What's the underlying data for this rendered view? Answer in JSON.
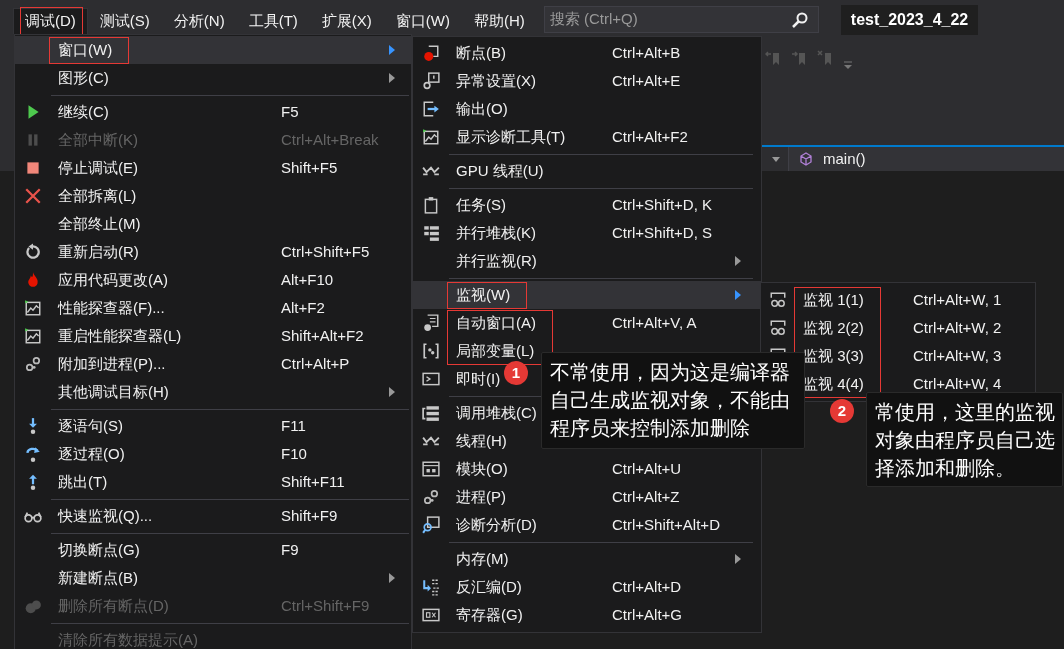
{
  "menubar": [
    {
      "label": "调试(D)",
      "selected": true,
      "annotated": true
    },
    {
      "label": "测试(S)",
      "selected": false,
      "annotated": false
    },
    {
      "label": "分析(N)",
      "selected": false,
      "annotated": false
    },
    {
      "label": "工具(T)",
      "selected": false,
      "annotated": false
    },
    {
      "label": "扩展(X)",
      "selected": false,
      "annotated": false
    },
    {
      "label": "窗口(W)",
      "selected": false,
      "annotated": false
    },
    {
      "label": "帮助(H)",
      "selected": false,
      "annotated": false
    }
  ],
  "search": {
    "placeholder": "搜索 (Ctrl+Q)"
  },
  "solution_title": "test_2023_4_22",
  "editor": {
    "function_dropdown": "main()"
  },
  "debug_menu": [
    {
      "kind": "annotated_group",
      "items": [
        {
          "kind": "item",
          "label": "窗口(W)",
          "submenu": true,
          "selected": true,
          "disabled": false
        }
      ]
    },
    {
      "kind": "item",
      "label": "图形(C)",
      "submenu": true,
      "selected": false,
      "disabled": false
    },
    {
      "kind": "separator"
    },
    {
      "kind": "item",
      "label": "继续(C)",
      "shortcut": "F5",
      "submenu": false,
      "selected": false,
      "disabled": false
    },
    {
      "kind": "item",
      "label": "全部中断(K)",
      "shortcut": "Ctrl+Alt+Break",
      "submenu": false,
      "selected": false,
      "disabled": true
    },
    {
      "kind": "item",
      "label": "停止调试(E)",
      "shortcut": "Shift+F5",
      "submenu": false,
      "selected": false,
      "disabled": false
    },
    {
      "kind": "item",
      "label": "全部拆离(L)",
      "submenu": false,
      "selected": false,
      "disabled": false
    },
    {
      "kind": "item",
      "label": "全部终止(M)",
      "submenu": false,
      "selected": false,
      "disabled": false
    },
    {
      "kind": "item",
      "label": "重新启动(R)",
      "shortcut": "Ctrl+Shift+F5",
      "submenu": false,
      "selected": false,
      "disabled": false
    },
    {
      "kind": "item",
      "label": "应用代码更改(A)",
      "shortcut": "Alt+F10",
      "submenu": false,
      "selected": false,
      "disabled": false
    },
    {
      "kind": "item",
      "label": "性能探查器(F)...",
      "shortcut": "Alt+F2",
      "submenu": false,
      "selected": false,
      "disabled": false
    },
    {
      "kind": "item",
      "label": "重启性能探查器(L)",
      "shortcut": "Shift+Alt+F2",
      "submenu": false,
      "selected": false,
      "disabled": false
    },
    {
      "kind": "item",
      "label": "附加到进程(P)...",
      "shortcut": "Ctrl+Alt+P",
      "submenu": false,
      "selected": false,
      "disabled": false
    },
    {
      "kind": "item",
      "label": "其他调试目标(H)",
      "submenu": true,
      "selected": false,
      "disabled": false
    },
    {
      "kind": "separator"
    },
    {
      "kind": "item",
      "label": "逐语句(S)",
      "shortcut": "F11",
      "submenu": false,
      "selected": false,
      "disabled": false
    },
    {
      "kind": "item",
      "label": "逐过程(O)",
      "shortcut": "F10",
      "submenu": false,
      "selected": false,
      "disabled": false
    },
    {
      "kind": "item",
      "label": "跳出(T)",
      "shortcut": "Shift+F11",
      "submenu": false,
      "selected": false,
      "disabled": false
    },
    {
      "kind": "separator"
    },
    {
      "kind": "item",
      "label": "快速监视(Q)...",
      "shortcut": "Shift+F9",
      "submenu": false,
      "selected": false,
      "disabled": false
    },
    {
      "kind": "separator"
    },
    {
      "kind": "item",
      "label": "切换断点(G)",
      "shortcut": "F9",
      "submenu": false,
      "selected": false,
      "disabled": false
    },
    {
      "kind": "item",
      "label": "新建断点(B)",
      "submenu": true,
      "selected": false,
      "disabled": false
    },
    {
      "kind": "item",
      "label": "删除所有断点(D)",
      "shortcut": "Ctrl+Shift+F9",
      "submenu": false,
      "selected": false,
      "disabled": true
    },
    {
      "kind": "separator"
    },
    {
      "kind": "item",
      "label": "清除所有数据提示(A)",
      "submenu": false,
      "selected": false,
      "disabled": true
    }
  ],
  "window_submenu": [
    {
      "kind": "item",
      "label": "断点(B)",
      "shortcut": "Ctrl+Alt+B",
      "submenu": false,
      "selected": false,
      "disabled": false
    },
    {
      "kind": "item",
      "label": "异常设置(X)",
      "shortcut": "Ctrl+Alt+E",
      "submenu": false,
      "selected": false,
      "disabled": false
    },
    {
      "kind": "item",
      "label": "输出(O)",
      "submenu": false,
      "selected": false,
      "disabled": false
    },
    {
      "kind": "item",
      "label": "显示诊断工具(T)",
      "shortcut": "Ctrl+Alt+F2",
      "submenu": false,
      "selected": false,
      "disabled": false
    },
    {
      "kind": "separator"
    },
    {
      "kind": "item",
      "label": "GPU 线程(U)",
      "submenu": false,
      "selected": false,
      "disabled": false
    },
    {
      "kind": "separator"
    },
    {
      "kind": "item",
      "label": "任务(S)",
      "shortcut": "Ctrl+Shift+D, K",
      "submenu": false,
      "selected": false,
      "disabled": false
    },
    {
      "kind": "item",
      "label": "并行堆栈(K)",
      "shortcut": "Ctrl+Shift+D, S",
      "submenu": false,
      "selected": false,
      "disabled": false
    },
    {
      "kind": "item",
      "label": "并行监视(R)",
      "submenu": true,
      "selected": false,
      "disabled": false
    },
    {
      "kind": "separator"
    },
    {
      "kind": "annotated_group",
      "items": [
        {
          "kind": "item",
          "label": "监视(W)",
          "submenu": true,
          "selected": true,
          "disabled": false
        }
      ]
    },
    {
      "kind": "annotated_group",
      "items": [
        {
          "kind": "item",
          "label": "自动窗口(A)",
          "shortcut": "Ctrl+Alt+V, A",
          "submenu": false,
          "selected": false,
          "disabled": false
        },
        {
          "kind": "item",
          "label": "局部变量(L)",
          "submenu": false,
          "selected": false,
          "disabled": false
        }
      ]
    },
    {
      "kind": "item",
      "label": "即时(I)",
      "submenu": false,
      "selected": false,
      "disabled": false
    },
    {
      "kind": "separator"
    },
    {
      "kind": "item",
      "label": "调用堆栈(C)",
      "submenu": false,
      "selected": false,
      "disabled": false
    },
    {
      "kind": "item",
      "label": "线程(H)",
      "submenu": false,
      "selected": false,
      "disabled": false
    },
    {
      "kind": "item",
      "label": "模块(O)",
      "shortcut": "Ctrl+Alt+U",
      "submenu": false,
      "selected": false,
      "disabled": false
    },
    {
      "kind": "item",
      "label": "进程(P)",
      "shortcut": "Ctrl+Alt+Z",
      "submenu": false,
      "selected": false,
      "disabled": false
    },
    {
      "kind": "item",
      "label": "诊断分析(D)",
      "shortcut": "Ctrl+Shift+Alt+D",
      "submenu": false,
      "selected": false,
      "disabled": false
    },
    {
      "kind": "separator"
    },
    {
      "kind": "item",
      "label": "内存(M)",
      "submenu": true,
      "selected": false,
      "disabled": false
    },
    {
      "kind": "item",
      "label": "反汇编(D)",
      "shortcut": "Ctrl+Alt+D",
      "submenu": false,
      "selected": false,
      "disabled": false
    },
    {
      "kind": "item",
      "label": "寄存器(G)",
      "shortcut": "Ctrl+Alt+G",
      "submenu": false,
      "selected": false,
      "disabled": false
    }
  ],
  "watch_submenu": [
    {
      "kind": "annotated_group",
      "items": [
        {
          "kind": "item",
          "label": "监视 1(1)",
          "shortcut": "Ctrl+Alt+W, 1",
          "submenu": false,
          "selected": false,
          "disabled": false
        },
        {
          "kind": "item",
          "label": "监视 2(2)",
          "shortcut": "Ctrl+Alt+W, 2",
          "submenu": false,
          "selected": false,
          "disabled": false
        },
        {
          "kind": "item",
          "label": "监视 3(3)",
          "shortcut": "Ctrl+Alt+W, 3",
          "submenu": false,
          "selected": false,
          "disabled": false
        },
        {
          "kind": "item",
          "label": "监视 4(4)",
          "shortcut": "Ctrl+Alt+W, 4",
          "submenu": false,
          "selected": false,
          "disabled": false
        }
      ]
    }
  ],
  "callouts": [
    {
      "badge": "1",
      "text": "不常使用，因为这是编译器自己生成监视对象，不能由程序员来控制添加删除"
    },
    {
      "badge": "2",
      "text": "常使用，这里的监视对象由程序员自己选择添加和删除。"
    }
  ]
}
